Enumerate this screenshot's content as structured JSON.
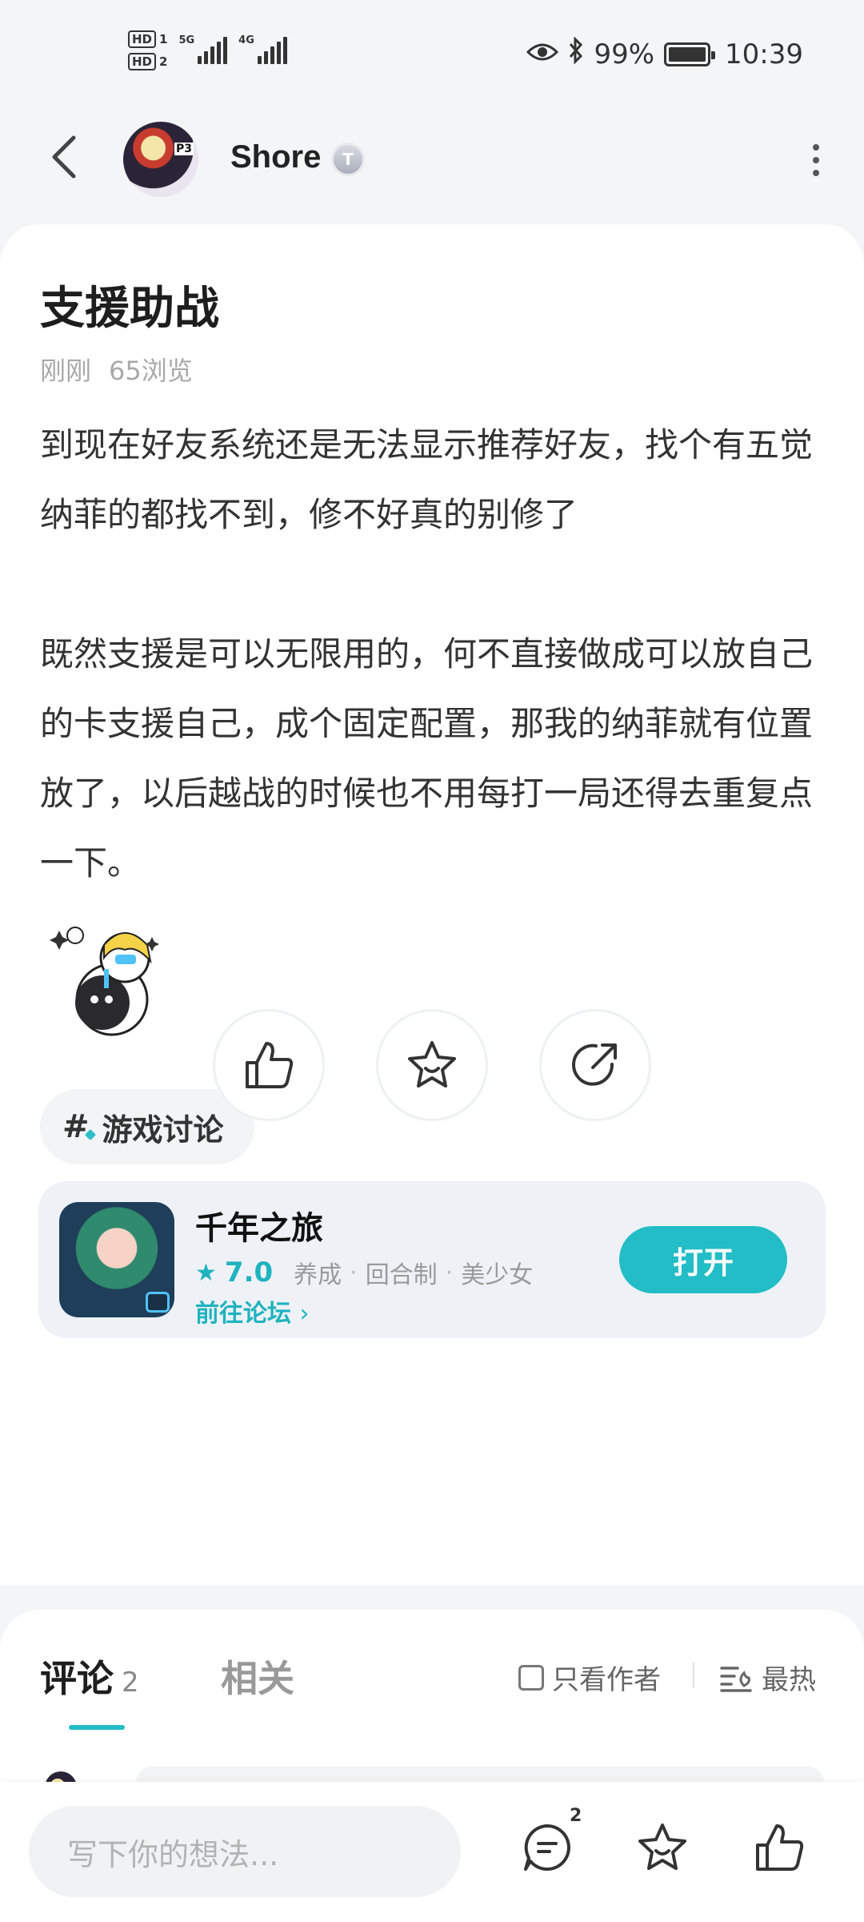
{
  "status_bar": {
    "hd1": "HD",
    "hd1_num": "1",
    "hd2": "HD",
    "hd2_num": "2",
    "net1": "5G",
    "net2": "4G",
    "battery": "99%",
    "time": "10:39",
    "battery_level": 0.99
  },
  "header": {
    "username": "Shore",
    "user_badge": "T",
    "avatar_text": "P3"
  },
  "post": {
    "title": "支援助战",
    "time": "刚刚",
    "views": "65浏览",
    "paragraph1": "到现在好友系统还是无法显示推荐好友，找个有五觉纳菲的都找不到，修不好真的别修了",
    "paragraph2": "既然支援是可以无限用的，何不直接做成可以放自己的卡支援自己，成个固定配置，那我的纳菲就有位置放了，以后越战的时候也不用每打一局还得去重复点一下。",
    "topic": "游戏讨论"
  },
  "actions": {
    "like_icon": "thumbs-up-icon",
    "favorite_icon": "star-icon",
    "share_icon": "share-icon"
  },
  "game": {
    "name": "千年之旅",
    "rating": "7.0",
    "tags": [
      "养成",
      "回合制",
      "美少女"
    ],
    "tag_separator": "·",
    "forum_link": "前往论坛",
    "open_button": "打开",
    "accent_color": "#22bdc6"
  },
  "comments": {
    "tab_comments": "评论",
    "comment_count": "2",
    "tab_related": "相关",
    "author_only": "只看作者",
    "sort": "最热"
  },
  "bottom_bar": {
    "input_placeholder": "写下你的想法...",
    "comment_badge": "2"
  }
}
